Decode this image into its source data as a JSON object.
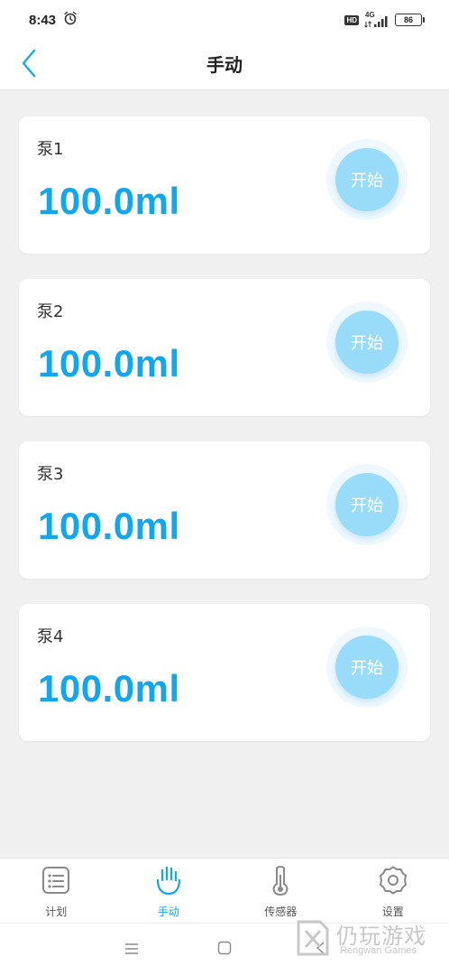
{
  "status_bar": {
    "time": "8:43",
    "hd_badge": "HD",
    "network": "4G",
    "battery": "86",
    "icons": [
      "alarm-icon",
      "signal-icon",
      "battery-icon"
    ]
  },
  "header": {
    "title": "手动",
    "back_icon": "chevron-left-icon"
  },
  "pumps": [
    {
      "label": "泵1",
      "value": "100.0ml",
      "button": "开始"
    },
    {
      "label": "泵2",
      "value": "100.0ml",
      "button": "开始"
    },
    {
      "label": "泵3",
      "value": "100.0ml",
      "button": "开始"
    },
    {
      "label": "泵4",
      "value": "100.0ml",
      "button": "开始"
    }
  ],
  "tabs": [
    {
      "label": "计划",
      "icon": "plan-list-icon",
      "active": false
    },
    {
      "label": "手动",
      "icon": "hand-icon",
      "active": true
    },
    {
      "label": "传感器",
      "icon": "thermometer-icon",
      "active": false
    },
    {
      "label": "设置",
      "icon": "gear-icon",
      "active": false
    }
  ],
  "system_nav": {
    "icons": [
      "menu-icon",
      "home-icon",
      "back-icon"
    ]
  },
  "watermark": {
    "title": "仍玩游戏",
    "subtitle": "Rengwan Games"
  },
  "colors": {
    "accent": "#12a6ef",
    "button_fill": "#99dcfa",
    "background": "#f0f0f0"
  }
}
